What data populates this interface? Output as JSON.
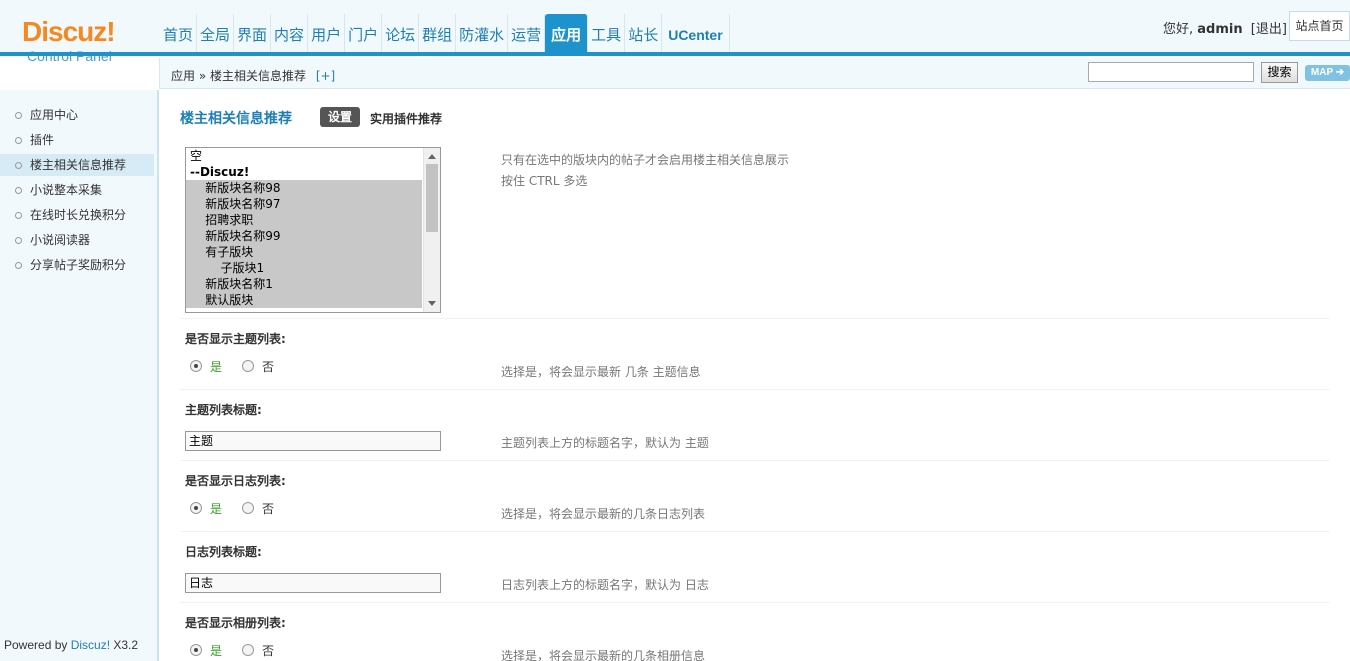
{
  "header": {
    "logo_main": "Discuz!",
    "logo_sub": "Control Panel",
    "nav": [
      "首页",
      "全局",
      "界面",
      "内容",
      "用户",
      "门户",
      "论坛",
      "群组",
      "防灌水",
      "运营",
      "应用",
      "工具",
      "站长",
      "UCenter"
    ],
    "active_nav": "应用",
    "greeting": "您好,",
    "username": "admin",
    "logout": "[退出]",
    "site_home": "站点首页"
  },
  "breadcrumb": {
    "path": "应用 » 楼主相关信息推荐",
    "plus": "[+]",
    "search_button": "搜索",
    "map_button": "MAP ➔"
  },
  "sidebar": {
    "items": [
      "应用中心",
      "插件",
      "楼主相关信息推荐",
      "小说整本采集",
      "在线时长兑换积分",
      "小说阅读器",
      "分享帖子奖励积分"
    ],
    "active": "楼主相关信息推荐",
    "powered_prefix": "Powered by ",
    "powered_brand": "Discuz!",
    "powered_version": " X3.2"
  },
  "main": {
    "title": "楼主相关信息推荐",
    "tabs": [
      "设置",
      "实用插件推荐"
    ],
    "forum_select": {
      "options": [
        {
          "label": "空",
          "selected": false,
          "bold": false
        },
        {
          "label": "--Discuz!",
          "selected": false,
          "bold": true
        },
        {
          "label": "    新版块名称98",
          "selected": true,
          "bold": false
        },
        {
          "label": "    新版块名称97",
          "selected": true,
          "bold": false
        },
        {
          "label": "    招聘求职",
          "selected": true,
          "bold": false
        },
        {
          "label": "    新版块名称99",
          "selected": true,
          "bold": false
        },
        {
          "label": "    有子版块",
          "selected": true,
          "bold": false
        },
        {
          "label": "        子版块1",
          "selected": true,
          "bold": false
        },
        {
          "label": "    新版块名称1",
          "selected": true,
          "bold": false
        },
        {
          "label": "    默认版块",
          "selected": true,
          "bold": false
        }
      ],
      "tip1": "只有在选中的版块内的帖子才会启用楼主相关信息展示",
      "tip2": "按住 CTRL 多选"
    },
    "rows": [
      {
        "label": "是否显示主题列表:",
        "type": "radio",
        "yes": "是",
        "no": "否",
        "tip": "选择是，将会显示最新 几条 主题信息"
      },
      {
        "label": "主题列表标题:",
        "type": "text",
        "value": "主题",
        "tip": "主题列表上方的标题名字，默认为 主题"
      },
      {
        "label": "是否显示日志列表:",
        "type": "radio",
        "yes": "是",
        "no": "否",
        "tip": "选择是，将会显示最新的几条日志列表"
      },
      {
        "label": "日志列表标题:",
        "type": "text",
        "value": "日志",
        "tip": "日志列表上方的标题名字，默认为 日志"
      },
      {
        "label": "是否显示相册列表:",
        "type": "radio",
        "yes": "是",
        "no": "否",
        "tip": "选择是，将会显示最新的几条相册信息"
      }
    ]
  }
}
